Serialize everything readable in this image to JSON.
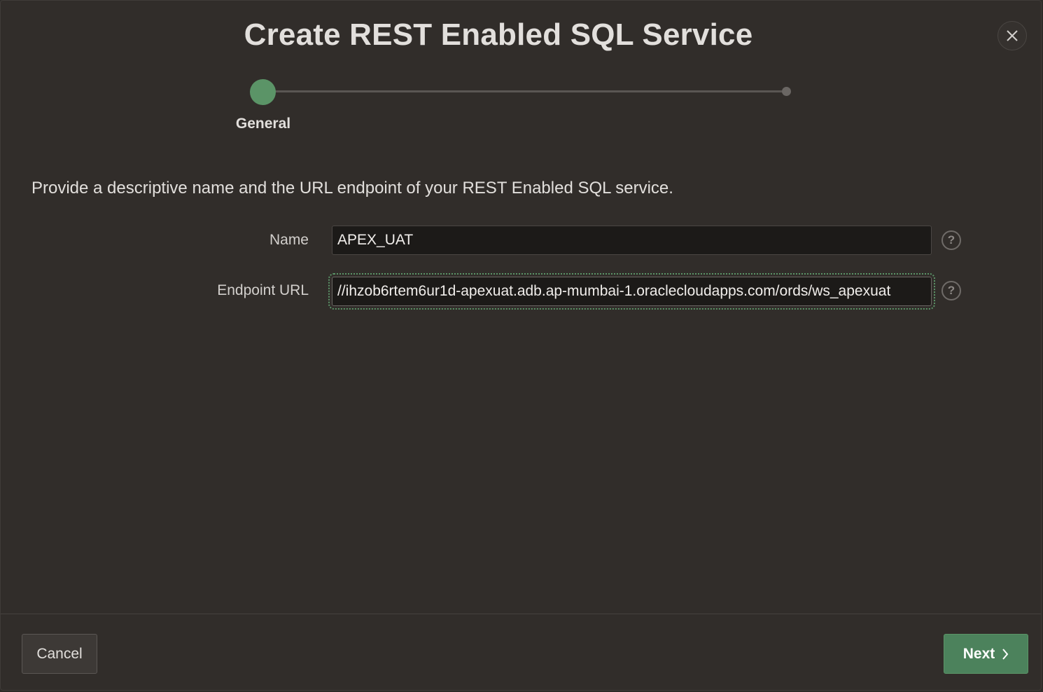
{
  "dialog": {
    "title": "Create REST Enabled SQL Service",
    "close_icon": "close-icon"
  },
  "wizard": {
    "steps": [
      {
        "label": "General",
        "active": true
      }
    ],
    "active_color": "#5b9467"
  },
  "instructions": "Provide a descriptive name and the URL endpoint of your REST Enabled SQL service.",
  "form": {
    "name": {
      "label": "Name",
      "value": "APEX_UAT",
      "help_icon": "help-icon"
    },
    "endpoint_url": {
      "label": "Endpoint URL",
      "value": "//ihzob6rtem6ur1d-apexuat.adb.ap-mumbai-1.oraclecloudapps.com/ords/ws_apexuat",
      "help_icon": "help-icon"
    }
  },
  "footer": {
    "cancel_label": "Cancel",
    "next_label": "Next",
    "next_icon": "chevron-right-icon"
  },
  "help_glyph": "?",
  "colors": {
    "background": "#312d2a",
    "accent": "#5b9467",
    "primary_button": "#4c825c"
  }
}
